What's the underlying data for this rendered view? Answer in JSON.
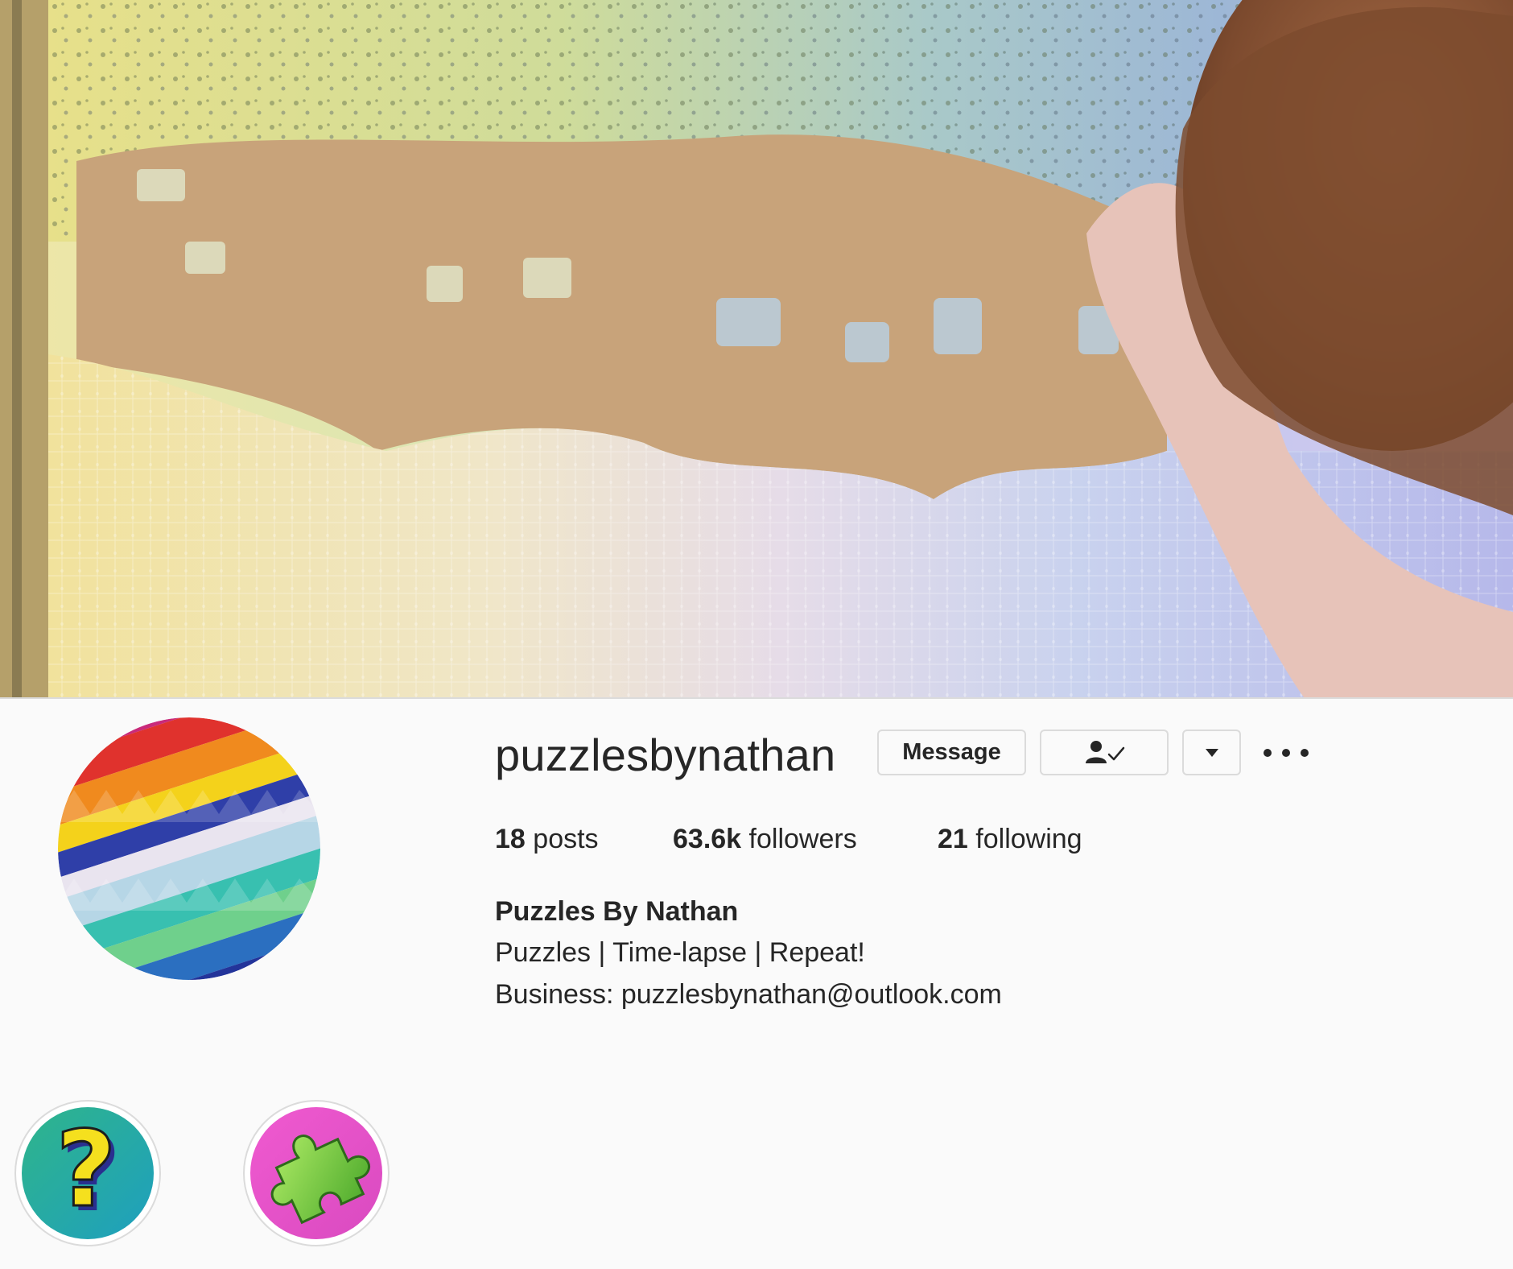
{
  "profile": {
    "username": "puzzlesbynathan",
    "message_label": "Message",
    "follow_status_icon": "person-check-icon",
    "suggest_icon": "caret-down-icon",
    "more_icon": "more-options-icon",
    "stats": {
      "posts_count": "18",
      "posts_label": "posts",
      "followers_count": "63.6k",
      "followers_label": "followers",
      "following_count": "21",
      "following_label": "following"
    },
    "full_name": "Puzzles By Nathan",
    "bio_line1": "Puzzles | Time-lapse | Repeat!",
    "bio_line2": "Business: puzzlesbynathan@outlook.com"
  },
  "highlights": [
    {
      "icon": "question-mark-icon"
    },
    {
      "icon": "puzzle-piece-icon"
    }
  ],
  "colors": {
    "text": "#262626",
    "border": "#dbdbdb",
    "background": "#fafafa",
    "highlight1_bg": "#1fa7a0",
    "highlight2_bg": "#e54fc8"
  }
}
